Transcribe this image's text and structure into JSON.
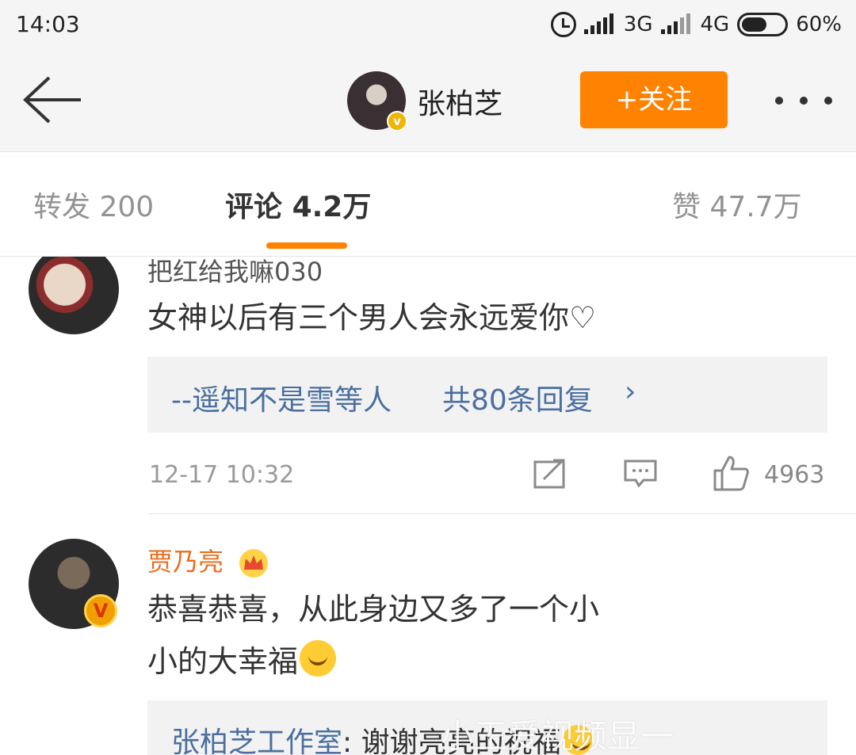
{
  "status_bar": {
    "time": "14:03",
    "network_1": "3G",
    "network_2": "4G",
    "battery": "60%",
    "battery_level": 0.6
  },
  "nav": {
    "title": "张柏芝",
    "follow_label": "+关注",
    "icons": [
      "back-arrow-icon",
      "more-icon",
      "verified-badge-icon"
    ],
    "accent_color": "#ff8200"
  },
  "tabs": [
    {
      "label": "转发",
      "count": "200"
    },
    {
      "label": "评论",
      "count": "4.2万",
      "active": true
    },
    {
      "label": "赞",
      "count": "47.7万"
    }
  ],
  "comments": [
    {
      "username": "把红给我嘛030",
      "text": "女神以后有三个男人会永远爱你♡",
      "reply_summary": {
        "author": "--遥知不是雪等人",
        "count_label": "共80条回复",
        "chevron": "›"
      },
      "time": "12-17 10:32",
      "likes": "4963"
    },
    {
      "username": "贾乃亮",
      "badge": "crown-icon",
      "verified": true,
      "text_lines": [
        "恭喜恭喜，从此身边又多了一个小",
        "小的大幸福"
      ],
      "emoji": "hug-emoji-icon",
      "reply": {
        "author": "张柏芝工作室",
        "text": ": 谢谢亮亮的祝福"
      }
    }
  ],
  "watermark": "小王爱视频显一"
}
